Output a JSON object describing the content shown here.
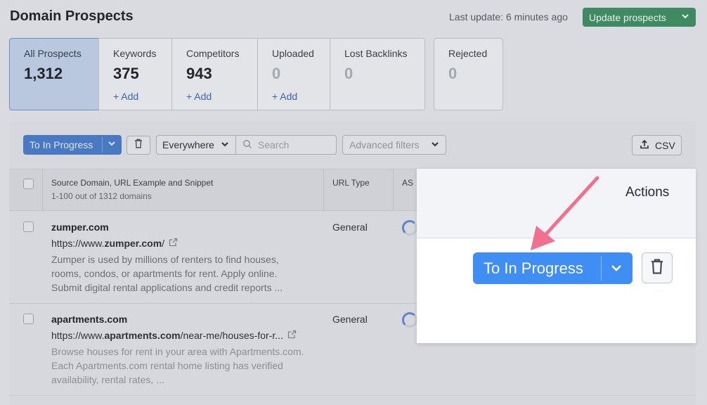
{
  "header": {
    "title": "Domain Prospects",
    "last_update": "Last update: 6 minutes ago",
    "update_button": "Update prospects"
  },
  "tabs": [
    {
      "label": "All Prospects",
      "count": "1,312",
      "add": ""
    },
    {
      "label": "Keywords",
      "count": "375",
      "add": "+ Add"
    },
    {
      "label": "Competitors",
      "count": "943",
      "add": "+ Add"
    },
    {
      "label": "Uploaded",
      "count": "0",
      "add": "+ Add"
    },
    {
      "label": "Lost Backlinks",
      "count": "0",
      "add": ""
    },
    {
      "label": "Rejected",
      "count": "0",
      "add": ""
    }
  ],
  "toolbar": {
    "progress_button": "To In Progress",
    "scope_select": "Everywhere",
    "search_placeholder": "Search",
    "advanced_filters": "Advanced filters",
    "csv_button": "CSV"
  },
  "table": {
    "columns": {
      "source": "Source Domain, URL Example and Snippet",
      "source_sub": "1-100 out of 1312 domains",
      "url_type": "URL Type",
      "as": "AS"
    },
    "rows": [
      {
        "domain": "zumper.com",
        "url_prefix": "https://www.",
        "url_bold": "zumper.com",
        "url_suffix": "/",
        "snippet": "Zumper is used by millions of renters to find houses, rooms, condos, or apartments for rent. Apply online. Submit digital rental applications and credit reports ...",
        "url_type": "General"
      },
      {
        "domain": "apartments.com",
        "url_prefix": "https://www.",
        "url_bold": "apartments.com",
        "url_suffix": "/near-me/houses-for-r...",
        "snippet": "Browse houses for rent in your area with Apartments.com. Each Apartments.com rental home listing has verified availability, rental rates, ...",
        "url_type": "General"
      }
    ]
  },
  "zoom": {
    "actions_label": "Actions",
    "progress_button": "To In Progress"
  },
  "colors": {
    "accent_green": "#3f8a63",
    "accent_blue": "#3f8ef3",
    "arrow_pink": "#f2708f"
  }
}
